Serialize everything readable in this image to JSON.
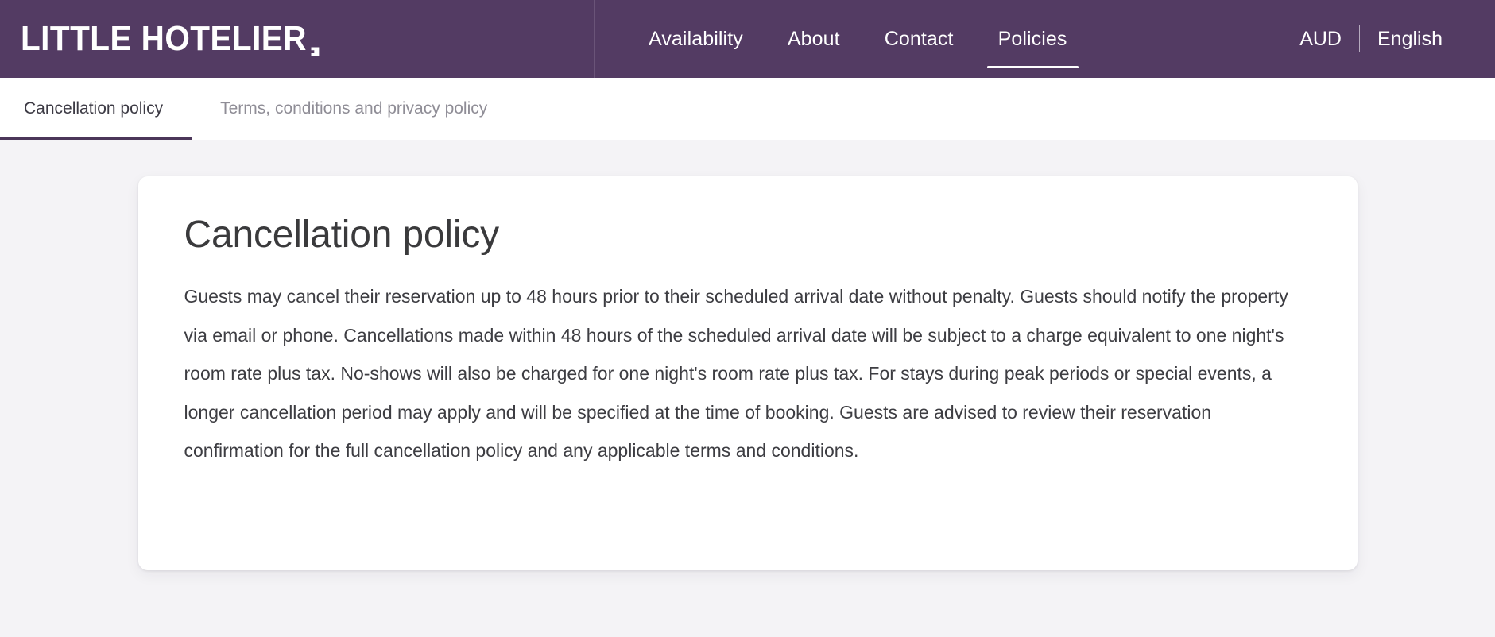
{
  "header": {
    "logo_text": "LITTLE HOTELIER",
    "nav_items": [
      {
        "label": "Availability",
        "active": false
      },
      {
        "label": "About",
        "active": false
      },
      {
        "label": "Contact",
        "active": false
      },
      {
        "label": "Policies",
        "active": true
      }
    ],
    "currency": "AUD",
    "language": "English",
    "background_color": "#533b63"
  },
  "tabs": [
    {
      "label": "Cancellation policy",
      "active": true
    },
    {
      "label": "Terms, conditions and privacy policy",
      "active": false
    }
  ],
  "card": {
    "title": "Cancellation policy",
    "body": "Guests may cancel their reservation up to 48 hours prior to their scheduled arrival date without penalty. Guests should notify the property via email or phone. Cancellations made within 48 hours of the scheduled arrival date will be subject to a charge equivalent to one night's room rate plus tax. No-shows will also be charged for one night's room rate plus tax. For stays during peak periods or special events, a longer cancellation period may apply and will be specified at the time of booking. Guests are advised to review their reservation confirmation for the full cancellation policy and any applicable terms and conditions."
  },
  "colors": {
    "brand_purple": "#533b63",
    "tab_active_underline": "#4b3659",
    "page_background": "#f4f3f6",
    "card_background": "#ffffff"
  }
}
